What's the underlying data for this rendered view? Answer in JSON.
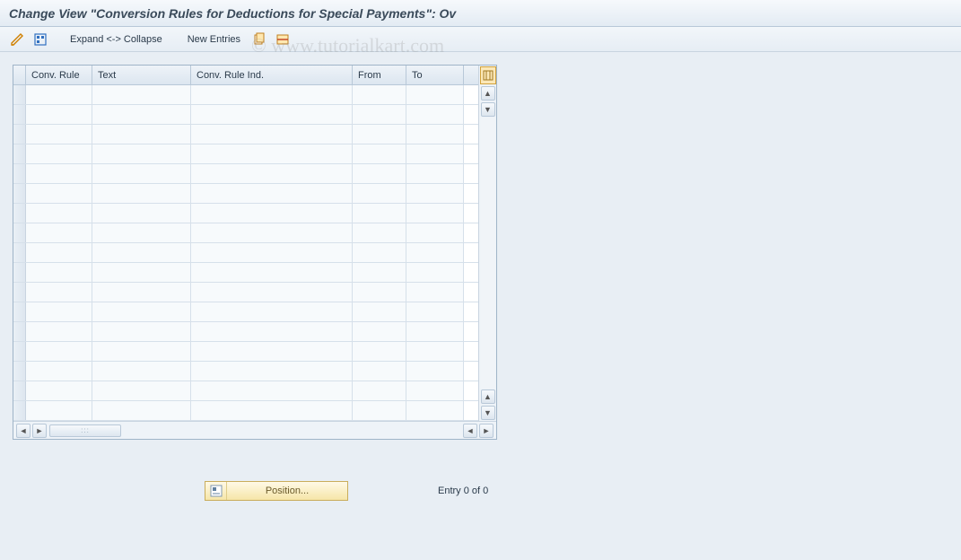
{
  "title": "Change View \"Conversion Rules for Deductions for Special Payments\": Ov",
  "toolbar": {
    "expand_collapse": "Expand <-> Collapse",
    "new_entries": "New Entries"
  },
  "table": {
    "columns": {
      "conv_rule": "Conv. Rule",
      "text": "Text",
      "conv_rule_ind": "Conv. Rule Ind.",
      "from": "From",
      "to": "To"
    },
    "rows": [
      {
        "conv_rule": "",
        "text": "",
        "conv_rule_ind": "",
        "from": "",
        "to": ""
      },
      {
        "conv_rule": "",
        "text": "",
        "conv_rule_ind": "",
        "from": "",
        "to": ""
      },
      {
        "conv_rule": "",
        "text": "",
        "conv_rule_ind": "",
        "from": "",
        "to": ""
      },
      {
        "conv_rule": "",
        "text": "",
        "conv_rule_ind": "",
        "from": "",
        "to": ""
      },
      {
        "conv_rule": "",
        "text": "",
        "conv_rule_ind": "",
        "from": "",
        "to": ""
      },
      {
        "conv_rule": "",
        "text": "",
        "conv_rule_ind": "",
        "from": "",
        "to": ""
      },
      {
        "conv_rule": "",
        "text": "",
        "conv_rule_ind": "",
        "from": "",
        "to": ""
      },
      {
        "conv_rule": "",
        "text": "",
        "conv_rule_ind": "",
        "from": "",
        "to": ""
      },
      {
        "conv_rule": "",
        "text": "",
        "conv_rule_ind": "",
        "from": "",
        "to": ""
      },
      {
        "conv_rule": "",
        "text": "",
        "conv_rule_ind": "",
        "from": "",
        "to": ""
      },
      {
        "conv_rule": "",
        "text": "",
        "conv_rule_ind": "",
        "from": "",
        "to": ""
      },
      {
        "conv_rule": "",
        "text": "",
        "conv_rule_ind": "",
        "from": "",
        "to": ""
      },
      {
        "conv_rule": "",
        "text": "",
        "conv_rule_ind": "",
        "from": "",
        "to": ""
      },
      {
        "conv_rule": "",
        "text": "",
        "conv_rule_ind": "",
        "from": "",
        "to": ""
      },
      {
        "conv_rule": "",
        "text": "",
        "conv_rule_ind": "",
        "from": "",
        "to": ""
      },
      {
        "conv_rule": "",
        "text": "",
        "conv_rule_ind": "",
        "from": "",
        "to": ""
      },
      {
        "conv_rule": "",
        "text": "",
        "conv_rule_ind": "",
        "from": "",
        "to": ""
      }
    ]
  },
  "footer": {
    "position_label": "Position...",
    "entry_status": "Entry 0 of 0"
  },
  "watermark": "© www.tutorialkart.com"
}
